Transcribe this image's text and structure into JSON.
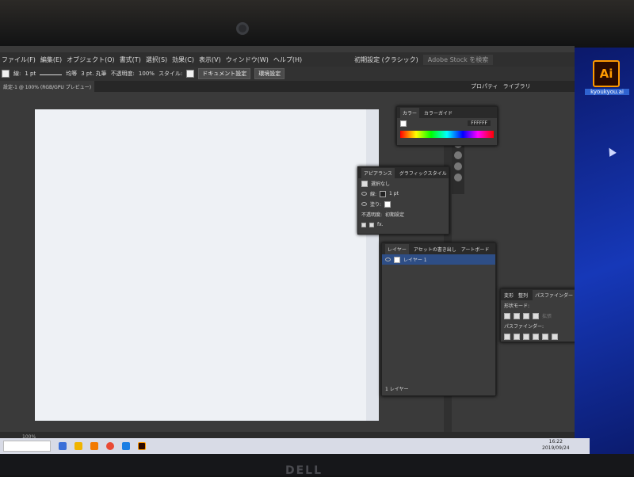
{
  "menu": [
    "ファイル(F)",
    "編集(E)",
    "オブジェクト(O)",
    "書式(T)",
    "選択(S)",
    "効果(C)",
    "表示(V)",
    "ウィンドウ(W)",
    "ヘルプ(H)"
  ],
  "workspace": "初期設定 (クラシック)",
  "stock_search_placeholder": "Adobe Stock を検索",
  "options": {
    "stroke_label": "線:",
    "stroke_value": "1 pt",
    "stroke_style": "均等",
    "brush": "3 pt. 丸筆",
    "opacity_label": "不透明度:",
    "opacity_value": "100%",
    "style_label": "スタイル:",
    "doc_setup": "ドキュメント設定",
    "preferences": "環境設定"
  },
  "doc_tab": "設定-1 @ 100% (RGB/GPU プレビュー)",
  "panel_tabs": [
    "プロパティ",
    "ライブラリ"
  ],
  "color_panel": {
    "tabs": [
      "カラー",
      "カラーガイド"
    ],
    "hex": "FFFFFF"
  },
  "appearance_panel": {
    "tabs": [
      "アピアランス",
      "グラフィックスタイル"
    ],
    "selection": "選択なし",
    "stroke_label": "線:",
    "stroke_value": "1 pt",
    "fill_label": "塗り:",
    "opacity_label": "不透明度:",
    "opacity_value": "初期設定",
    "fx": "fx."
  },
  "layers_panel": {
    "tabs": [
      "レイヤー",
      "アセットの書き出し",
      "アートボード"
    ],
    "layer_name": "レイヤー 1",
    "footer": "1 レイヤー"
  },
  "pathfinder_panel": {
    "tabs": [
      "変形",
      "整列",
      "パスファインダー"
    ],
    "shape_modes": "形状モード:",
    "pathfinders": "パスファインダー:",
    "expand": "拡張"
  },
  "status": {
    "zoom": "100%"
  },
  "desktop_icon": {
    "label": "kyoukyou.ai",
    "glyph": "Ai"
  },
  "clock": {
    "time": "16:22",
    "date": "2019/09/24"
  },
  "brand": "DELL"
}
